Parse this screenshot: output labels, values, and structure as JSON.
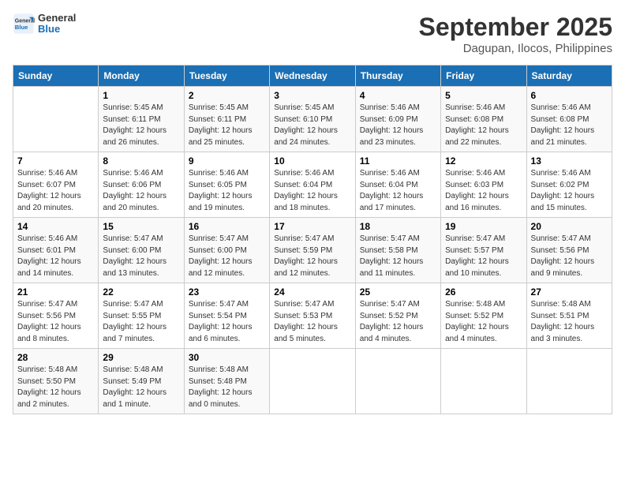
{
  "header": {
    "logo_text1": "General",
    "logo_text2": "Blue",
    "month": "September 2025",
    "location": "Dagupan, Ilocos, Philippines"
  },
  "columns": [
    "Sunday",
    "Monday",
    "Tuesday",
    "Wednesday",
    "Thursday",
    "Friday",
    "Saturday"
  ],
  "weeks": [
    [
      {
        "day": "",
        "info": ""
      },
      {
        "day": "1",
        "info": "Sunrise: 5:45 AM\nSunset: 6:11 PM\nDaylight: 12 hours\nand 26 minutes."
      },
      {
        "day": "2",
        "info": "Sunrise: 5:45 AM\nSunset: 6:11 PM\nDaylight: 12 hours\nand 25 minutes."
      },
      {
        "day": "3",
        "info": "Sunrise: 5:45 AM\nSunset: 6:10 PM\nDaylight: 12 hours\nand 24 minutes."
      },
      {
        "day": "4",
        "info": "Sunrise: 5:46 AM\nSunset: 6:09 PM\nDaylight: 12 hours\nand 23 minutes."
      },
      {
        "day": "5",
        "info": "Sunrise: 5:46 AM\nSunset: 6:08 PM\nDaylight: 12 hours\nand 22 minutes."
      },
      {
        "day": "6",
        "info": "Sunrise: 5:46 AM\nSunset: 6:08 PM\nDaylight: 12 hours\nand 21 minutes."
      }
    ],
    [
      {
        "day": "7",
        "info": "Sunrise: 5:46 AM\nSunset: 6:07 PM\nDaylight: 12 hours\nand 20 minutes."
      },
      {
        "day": "8",
        "info": "Sunrise: 5:46 AM\nSunset: 6:06 PM\nDaylight: 12 hours\nand 20 minutes."
      },
      {
        "day": "9",
        "info": "Sunrise: 5:46 AM\nSunset: 6:05 PM\nDaylight: 12 hours\nand 19 minutes."
      },
      {
        "day": "10",
        "info": "Sunrise: 5:46 AM\nSunset: 6:04 PM\nDaylight: 12 hours\nand 18 minutes."
      },
      {
        "day": "11",
        "info": "Sunrise: 5:46 AM\nSunset: 6:04 PM\nDaylight: 12 hours\nand 17 minutes."
      },
      {
        "day": "12",
        "info": "Sunrise: 5:46 AM\nSunset: 6:03 PM\nDaylight: 12 hours\nand 16 minutes."
      },
      {
        "day": "13",
        "info": "Sunrise: 5:46 AM\nSunset: 6:02 PM\nDaylight: 12 hours\nand 15 minutes."
      }
    ],
    [
      {
        "day": "14",
        "info": "Sunrise: 5:46 AM\nSunset: 6:01 PM\nDaylight: 12 hours\nand 14 minutes."
      },
      {
        "day": "15",
        "info": "Sunrise: 5:47 AM\nSunset: 6:00 PM\nDaylight: 12 hours\nand 13 minutes."
      },
      {
        "day": "16",
        "info": "Sunrise: 5:47 AM\nSunset: 6:00 PM\nDaylight: 12 hours\nand 12 minutes."
      },
      {
        "day": "17",
        "info": "Sunrise: 5:47 AM\nSunset: 5:59 PM\nDaylight: 12 hours\nand 12 minutes."
      },
      {
        "day": "18",
        "info": "Sunrise: 5:47 AM\nSunset: 5:58 PM\nDaylight: 12 hours\nand 11 minutes."
      },
      {
        "day": "19",
        "info": "Sunrise: 5:47 AM\nSunset: 5:57 PM\nDaylight: 12 hours\nand 10 minutes."
      },
      {
        "day": "20",
        "info": "Sunrise: 5:47 AM\nSunset: 5:56 PM\nDaylight: 12 hours\nand 9 minutes."
      }
    ],
    [
      {
        "day": "21",
        "info": "Sunrise: 5:47 AM\nSunset: 5:56 PM\nDaylight: 12 hours\nand 8 minutes."
      },
      {
        "day": "22",
        "info": "Sunrise: 5:47 AM\nSunset: 5:55 PM\nDaylight: 12 hours\nand 7 minutes."
      },
      {
        "day": "23",
        "info": "Sunrise: 5:47 AM\nSunset: 5:54 PM\nDaylight: 12 hours\nand 6 minutes."
      },
      {
        "day": "24",
        "info": "Sunrise: 5:47 AM\nSunset: 5:53 PM\nDaylight: 12 hours\nand 5 minutes."
      },
      {
        "day": "25",
        "info": "Sunrise: 5:47 AM\nSunset: 5:52 PM\nDaylight: 12 hours\nand 4 minutes."
      },
      {
        "day": "26",
        "info": "Sunrise: 5:48 AM\nSunset: 5:52 PM\nDaylight: 12 hours\nand 4 minutes."
      },
      {
        "day": "27",
        "info": "Sunrise: 5:48 AM\nSunset: 5:51 PM\nDaylight: 12 hours\nand 3 minutes."
      }
    ],
    [
      {
        "day": "28",
        "info": "Sunrise: 5:48 AM\nSunset: 5:50 PM\nDaylight: 12 hours\nand 2 minutes."
      },
      {
        "day": "29",
        "info": "Sunrise: 5:48 AM\nSunset: 5:49 PM\nDaylight: 12 hours\nand 1 minute."
      },
      {
        "day": "30",
        "info": "Sunrise: 5:48 AM\nSunset: 5:48 PM\nDaylight: 12 hours\nand 0 minutes."
      },
      {
        "day": "",
        "info": ""
      },
      {
        "day": "",
        "info": ""
      },
      {
        "day": "",
        "info": ""
      },
      {
        "day": "",
        "info": ""
      }
    ]
  ]
}
